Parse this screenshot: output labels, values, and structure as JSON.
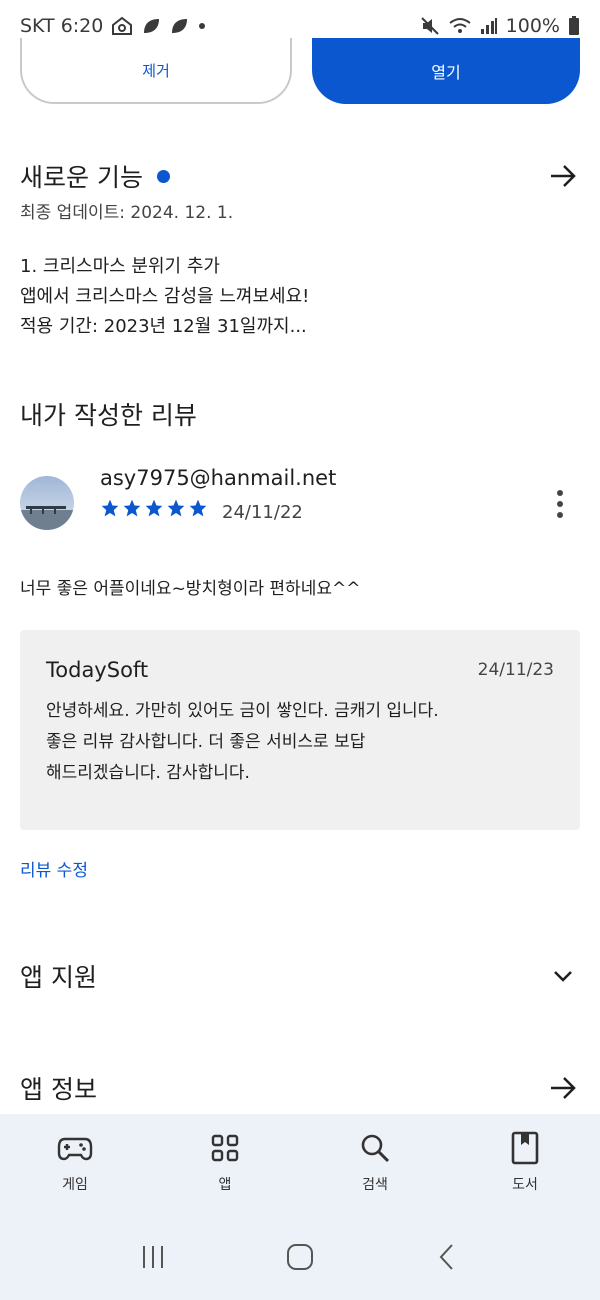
{
  "status": {
    "carrier_time": "SKT 6:20",
    "battery": "100%"
  },
  "actions": {
    "remove_label": "제거",
    "open_label": "열기"
  },
  "whats_new": {
    "title": "새로운 기능",
    "updated": "최종 업데이트: 2024. 12. 1.",
    "notes": [
      "1. 크리스마스 분위기 추가",
      "앱에서 크리스마스 감성을 느껴보세요!",
      "적용 기간: 2023년 12월 31일까지..."
    ]
  },
  "my_review": {
    "title": "내가 작성한 리뷰",
    "email": "asy7975@hanmail.net",
    "rating": 5,
    "date": "24/11/22",
    "body": "너무 좋은 어플이네요~방치형이라 편하네요^^",
    "reply": {
      "developer": "TodaySoft",
      "date": "24/11/23",
      "lines": [
        "안녕하세요. 가만히 있어도 금이 쌓인다. 금캐기 입니다.",
        "좋은 리뷰 감사합니다. 더 좋은 서비스로 보답",
        "해드리겠습니다. 감사합니다."
      ]
    },
    "edit_label": "리뷰 수정"
  },
  "sections": {
    "app_support": "앱 지원",
    "app_info": "앱 정보"
  },
  "bottom_nav": [
    {
      "label": "게임",
      "icon": "gamepad-icon"
    },
    {
      "label": "앱",
      "icon": "apps-grid-icon"
    },
    {
      "label": "검색",
      "icon": "search-icon"
    },
    {
      "label": "도서",
      "icon": "book-icon"
    }
  ],
  "colors": {
    "accent": "#0b57d0",
    "nav_bg": "#edf1f8",
    "reply_bg": "#f0f0f0"
  }
}
